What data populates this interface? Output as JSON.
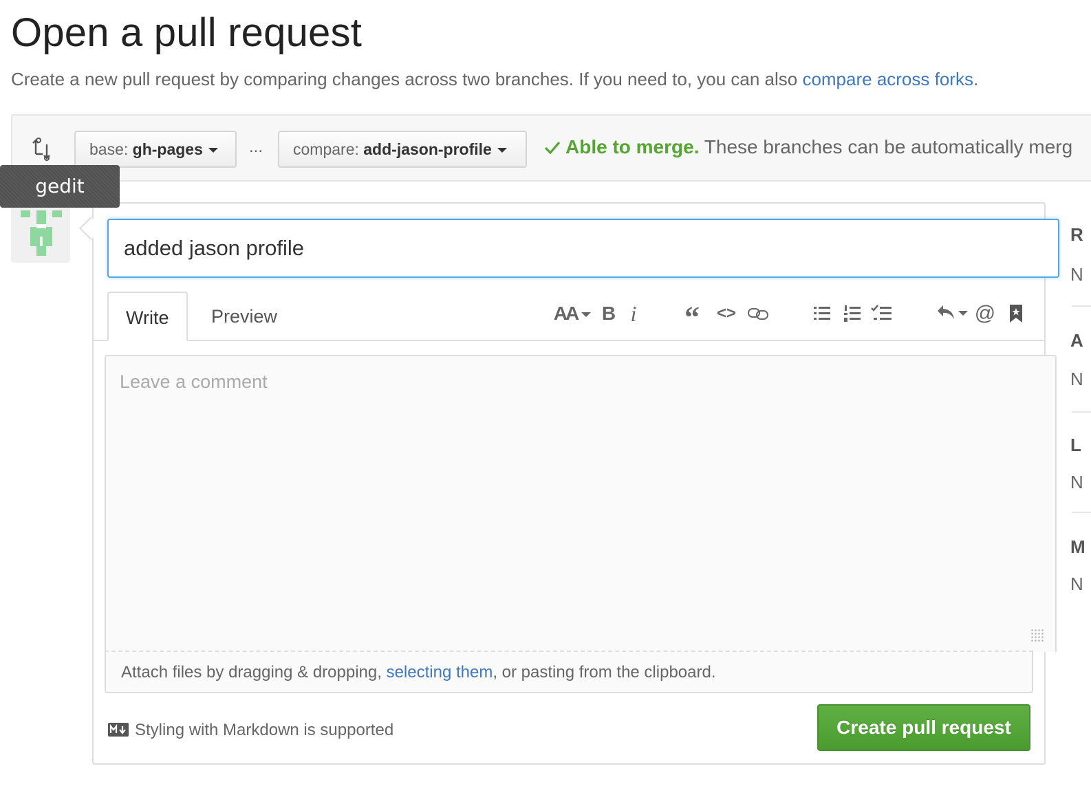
{
  "header": {
    "title": "Open a pull request",
    "subtitle_prefix": "Create a new pull request by comparing changes across two branches. If you need to, you can also ",
    "subtitle_link": "compare across forks",
    "subtitle_suffix": "."
  },
  "range": {
    "base_prefix": "base:",
    "base_branch": "gh-pages",
    "separator": "...",
    "compare_prefix": "compare:",
    "compare_branch": "add-jason-profile",
    "merge_ok": "Able to merge.",
    "merge_message": "These branches can be automatically merg"
  },
  "tooltip": {
    "label": "gedit"
  },
  "form": {
    "title_value": "added jason profile",
    "tabs": [
      "Write",
      "Preview"
    ],
    "toolbar": {
      "header": "AA",
      "bold": "B",
      "italic": "i",
      "quote": "“",
      "code": "<>",
      "at": "@"
    },
    "comment_placeholder": "Leave a comment",
    "attach_prefix": "Attach files by dragging & dropping, ",
    "attach_link": "selecting them",
    "attach_suffix": ", or pasting from the clipboard.",
    "markdown_note": "Styling with Markdown is supported",
    "submit_label": "Create pull request"
  },
  "sidebar": {
    "headings": [
      "R",
      "A",
      "L",
      "M"
    ],
    "values": [
      "N",
      "N",
      "N",
      "N"
    ]
  },
  "colors": {
    "link": "#4078c0",
    "success": "#55a532",
    "focus": "#51a7e8",
    "button_green": "#55a532"
  }
}
